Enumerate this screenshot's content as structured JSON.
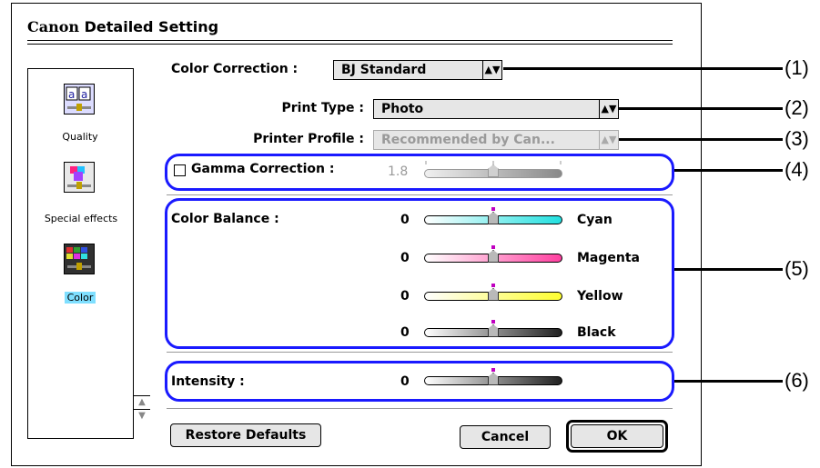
{
  "dialog": {
    "brand": "Canon",
    "title": "Detailed Setting"
  },
  "sidebar": {
    "items": [
      {
        "label": "Quality",
        "icon": "quality-icon"
      },
      {
        "label": "Special effects",
        "icon": "special-effects-icon"
      },
      {
        "label": "Color",
        "icon": "color-icon"
      }
    ],
    "selected": "Color"
  },
  "settings": {
    "color_correction": {
      "label": "Color Correction :",
      "value": "BJ Standard"
    },
    "print_type": {
      "label": "Print Type :",
      "value": "Photo"
    },
    "printer_profile": {
      "label": "Printer Profile :",
      "value": "Recommended by Can..."
    },
    "gamma": {
      "label": "Gamma Correction :",
      "value": "1.8",
      "checked": false
    },
    "color_balance": {
      "label": "Color Balance :",
      "sliders": [
        {
          "name": "Cyan",
          "value": "0",
          "color": "#22e0e0"
        },
        {
          "name": "Magenta",
          "value": "0",
          "color": "#ff40a0"
        },
        {
          "name": "Yellow",
          "value": "0",
          "color": "#ffff30"
        },
        {
          "name": "Black",
          "value": "0",
          "color": "#202020"
        }
      ]
    },
    "intensity": {
      "label": "Intensity :",
      "value": "0"
    }
  },
  "buttons": {
    "restore": "Restore Defaults",
    "cancel": "Cancel",
    "ok": "OK"
  },
  "callouts": [
    "(1)",
    "(2)",
    "(3)",
    "(4)",
    "(5)",
    "(6)"
  ],
  "colors": {
    "callout_border": "#1a1aff",
    "selected_highlight": "#7fdfff"
  }
}
